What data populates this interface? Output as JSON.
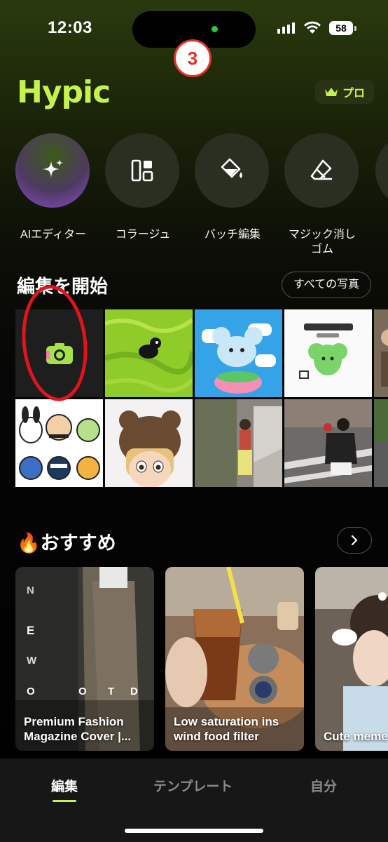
{
  "status_bar": {
    "time": "12:03",
    "battery": "58"
  },
  "step_badge": "3",
  "header": {
    "logo": "Hypic",
    "pro_label": "プロ"
  },
  "tools": [
    {
      "label": "AIエディター",
      "icon": "sparkle-icon"
    },
    {
      "label": "コラージュ",
      "icon": "layout-icon"
    },
    {
      "label": "バッチ編集",
      "icon": "paint-bucket-icon"
    },
    {
      "label": "マジック消し\nゴム",
      "icon": "eraser-icon"
    }
  ],
  "start_editing": {
    "title": "編集を開始",
    "all_photos": "すべての写真"
  },
  "recommend": {
    "title": "おすすめ",
    "cards": [
      {
        "title": "Premium Fashion\nMagazine Cover |..."
      },
      {
        "title": "Low saturation ins\nwind food filter"
      },
      {
        "title": "Cute meme"
      }
    ]
  },
  "bottom_nav": {
    "items": [
      "編集",
      "テンプレート",
      "自分"
    ],
    "active": "編集"
  },
  "colors": {
    "accent": "#c6f24e",
    "annotation": "#e0141c"
  }
}
